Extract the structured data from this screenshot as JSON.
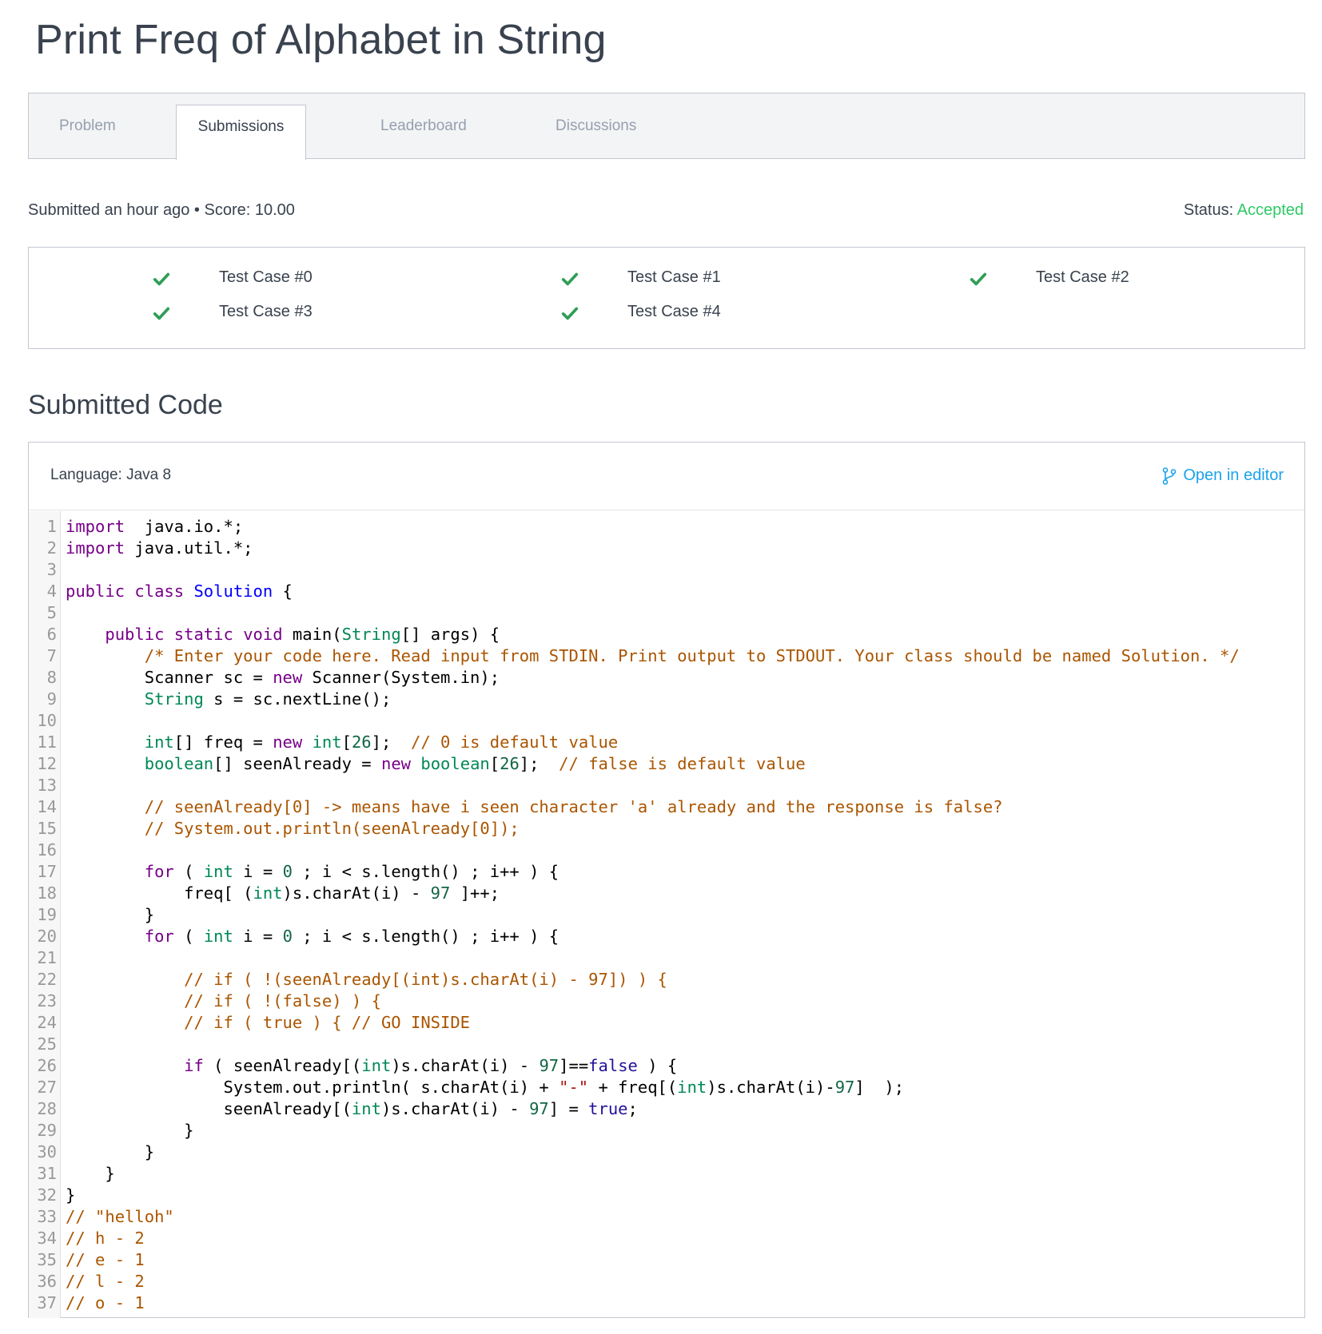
{
  "title": "Print Freq of Alphabet in String",
  "tabs": [
    {
      "label": "Problem",
      "active": false
    },
    {
      "label": "Submissions",
      "active": true
    },
    {
      "label": "Leaderboard",
      "active": false
    },
    {
      "label": "Discussions",
      "active": false
    }
  ],
  "submission": {
    "info": "Submitted an hour ago • Score: 10.00",
    "status_label": "Status: ",
    "status_value": "Accepted"
  },
  "test_cases": [
    {
      "label": "Test Case #0",
      "passed": true
    },
    {
      "label": "Test Case #1",
      "passed": true
    },
    {
      "label": "Test Case #2",
      "passed": true
    },
    {
      "label": "Test Case #3",
      "passed": true
    },
    {
      "label": "Test Case #4",
      "passed": true
    }
  ],
  "code_section": {
    "title": "Submitted Code",
    "language": "Language: Java 8",
    "open_editor": "Open in editor"
  },
  "code_lines": [
    [
      [
        "kw",
        "import"
      ],
      [
        "",
        "  java.io.*;"
      ]
    ],
    [
      [
        "kw",
        "import"
      ],
      [
        "",
        " java.util.*;"
      ]
    ],
    [],
    [
      [
        "kw",
        "public"
      ],
      [
        "",
        " "
      ],
      [
        "kw",
        "class"
      ],
      [
        "",
        " "
      ],
      [
        "cl",
        "Solution"
      ],
      [
        "",
        " {"
      ]
    ],
    [],
    [
      [
        "",
        "    "
      ],
      [
        "kw",
        "public"
      ],
      [
        "",
        " "
      ],
      [
        "kw",
        "static"
      ],
      [
        "",
        " "
      ],
      [
        "kw",
        "void"
      ],
      [
        "",
        " main("
      ],
      [
        "ty",
        "String"
      ],
      [
        "",
        "[] args) {"
      ]
    ],
    [
      [
        "",
        "        "
      ],
      [
        "cm",
        "/* Enter your code here. Read input from STDIN. Print output to STDOUT. Your class should be named Solution. */"
      ]
    ],
    [
      [
        "",
        "        Scanner sc = "
      ],
      [
        "kw",
        "new"
      ],
      [
        "",
        " Scanner(System.in);"
      ]
    ],
    [
      [
        "",
        "        "
      ],
      [
        "ty",
        "String"
      ],
      [
        "",
        " s = sc.nextLine();"
      ]
    ],
    [],
    [
      [
        "",
        "        "
      ],
      [
        "ty",
        "int"
      ],
      [
        "",
        "[] freq = "
      ],
      [
        "kw",
        "new"
      ],
      [
        "",
        " "
      ],
      [
        "ty",
        "int"
      ],
      [
        "",
        "["
      ],
      [
        "nm",
        "26"
      ],
      [
        "",
        "];  "
      ],
      [
        "cm",
        "// 0 is default value"
      ]
    ],
    [
      [
        "",
        "        "
      ],
      [
        "ty",
        "boolean"
      ],
      [
        "",
        "[] seenAlready = "
      ],
      [
        "kw",
        "new"
      ],
      [
        "",
        " "
      ],
      [
        "ty",
        "boolean"
      ],
      [
        "",
        "["
      ],
      [
        "nm",
        "26"
      ],
      [
        "",
        "];  "
      ],
      [
        "cm",
        "// false is default value"
      ]
    ],
    [],
    [
      [
        "",
        "        "
      ],
      [
        "cm",
        "// seenAlready[0] -> means have i seen character 'a' already and the response is false?"
      ]
    ],
    [
      [
        "",
        "        "
      ],
      [
        "cm",
        "// System.out.println(seenAlready[0]);"
      ]
    ],
    [],
    [
      [
        "",
        "        "
      ],
      [
        "kw",
        "for"
      ],
      [
        "",
        " ( "
      ],
      [
        "ty",
        "int"
      ],
      [
        "",
        " i = "
      ],
      [
        "nm",
        "0"
      ],
      [
        "",
        " ; i < s.length() ; i++ ) {"
      ]
    ],
    [
      [
        "",
        "            freq[ ("
      ],
      [
        "ty",
        "int"
      ],
      [
        "",
        ")s.charAt(i) - "
      ],
      [
        "nm",
        "97"
      ],
      [
        "",
        " ]++;"
      ]
    ],
    [
      [
        "",
        "        }"
      ]
    ],
    [
      [
        "",
        "        "
      ],
      [
        "kw",
        "for"
      ],
      [
        "",
        " ( "
      ],
      [
        "ty",
        "int"
      ],
      [
        "",
        " i = "
      ],
      [
        "nm",
        "0"
      ],
      [
        "",
        " ; i < s.length() ; i++ ) {"
      ]
    ],
    [],
    [
      [
        "",
        "            "
      ],
      [
        "cm",
        "// if ( !(seenAlready[(int)s.charAt(i) - 97]) ) {"
      ]
    ],
    [
      [
        "",
        "            "
      ],
      [
        "cm",
        "// if ( !(false) ) {"
      ]
    ],
    [
      [
        "",
        "            "
      ],
      [
        "cm",
        "// if ( true ) { // GO INSIDE"
      ]
    ],
    [],
    [
      [
        "",
        "            "
      ],
      [
        "kw",
        "if"
      ],
      [
        "",
        " ( seenAlready[("
      ],
      [
        "ty",
        "int"
      ],
      [
        "",
        ")s.charAt(i) - "
      ],
      [
        "nm",
        "97"
      ],
      [
        "",
        "]=="
      ],
      [
        "at",
        "false"
      ],
      [
        "",
        " ) {"
      ]
    ],
    [
      [
        "",
        "                System.out.println( s.charAt(i) + "
      ],
      [
        "st",
        "\"-\""
      ],
      [
        "",
        " + freq[("
      ],
      [
        "ty",
        "int"
      ],
      [
        "",
        ")s.charAt(i)-"
      ],
      [
        "nm",
        "97"
      ],
      [
        "",
        "]  );"
      ]
    ],
    [
      [
        "",
        "                seenAlready[("
      ],
      [
        "ty",
        "int"
      ],
      [
        "",
        ")s.charAt(i) - "
      ],
      [
        "nm",
        "97"
      ],
      [
        "",
        "] = "
      ],
      [
        "at",
        "true"
      ],
      [
        "",
        ";"
      ]
    ],
    [
      [
        "",
        "            }"
      ]
    ],
    [
      [
        "",
        "        }"
      ]
    ],
    [
      [
        "",
        "    }"
      ]
    ],
    [
      [
        "",
        "}"
      ]
    ],
    [
      [
        "cm",
        "// \"helloh\""
      ]
    ],
    [
      [
        "cm",
        "// h - 2"
      ]
    ],
    [
      [
        "cm",
        "// e - 1"
      ]
    ],
    [
      [
        "cm",
        "// l - 2"
      ]
    ],
    [
      [
        "cm",
        "// o - 1"
      ]
    ]
  ],
  "colors": {
    "accepted": "#2ec866",
    "check": "#2ec866",
    "link": "#1ba3ec",
    "keyword": "#770088",
    "type": "#008855",
    "comment": "#aa5500",
    "number": "#116644"
  }
}
